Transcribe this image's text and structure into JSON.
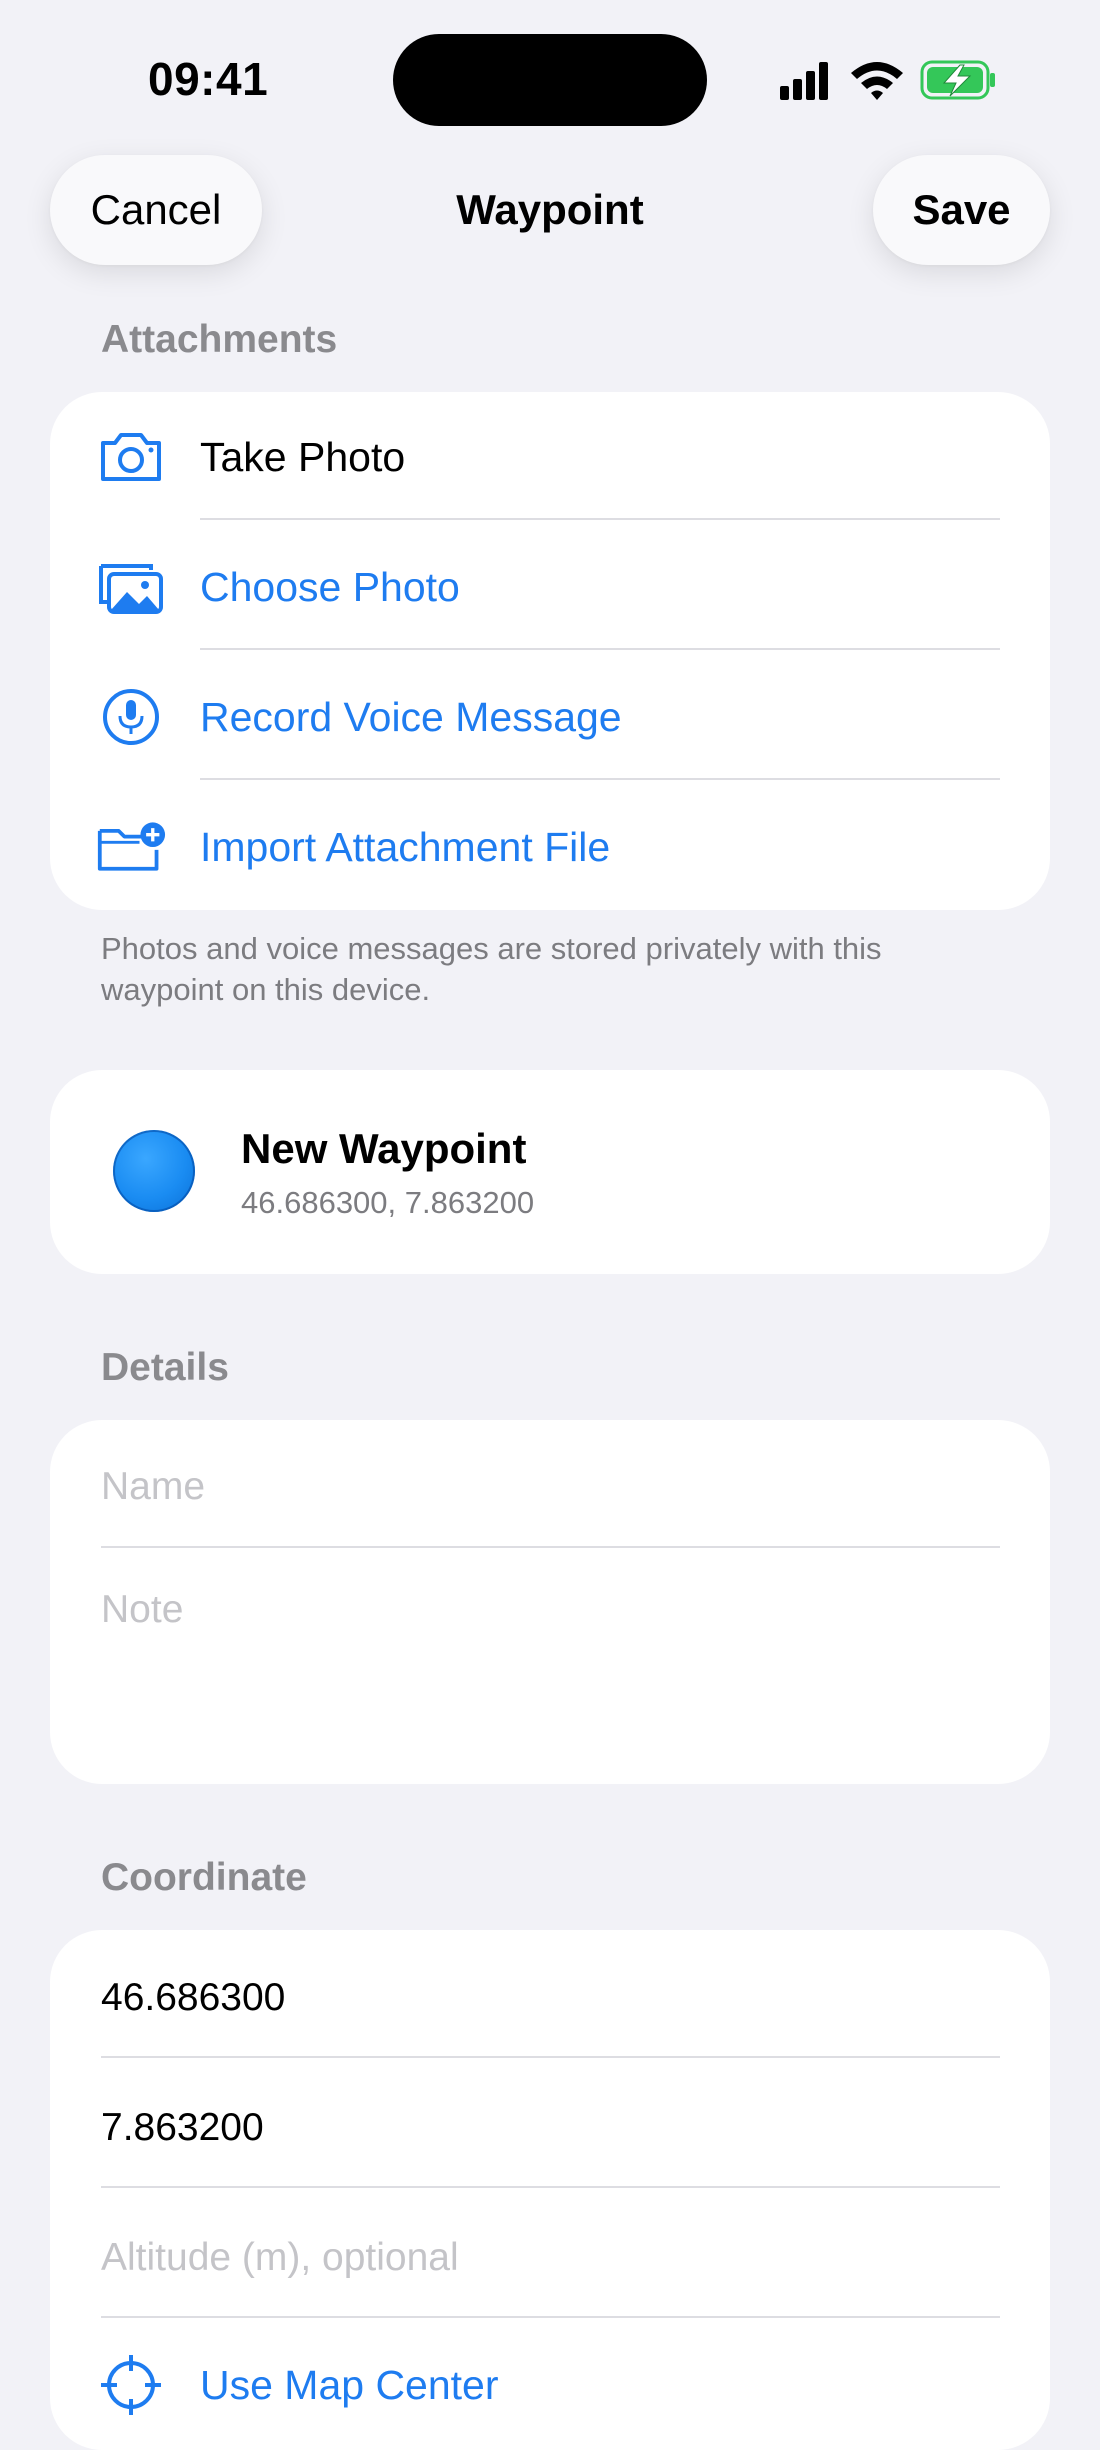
{
  "status_bar": {
    "time": "09:41"
  },
  "nav": {
    "cancel_label": "Cancel",
    "title": "Waypoint",
    "save_label": "Save"
  },
  "attachments": {
    "header": "Attachments",
    "items": [
      {
        "label": "Take Photo",
        "icon": "camera-icon"
      },
      {
        "label": "Choose Photo",
        "icon": "photo-library-icon"
      },
      {
        "label": "Record Voice Message",
        "icon": "microphone-icon"
      },
      {
        "label": "Import Attachment File",
        "icon": "folder-add-icon"
      }
    ],
    "footer": "Photos and voice messages are stored privately with this waypoint on this device."
  },
  "waypoint": {
    "name": "New Waypoint",
    "coords": "46.686300, 7.863200",
    "color": "#1A8CF2"
  },
  "details": {
    "header": "Details",
    "name_placeholder": "Name",
    "note_placeholder": "Note"
  },
  "coordinate": {
    "header": "Coordinate",
    "latitude": "46.686300",
    "longitude": "7.863200",
    "altitude_placeholder": "Altitude (m), optional",
    "map_center_label": "Use Map Center"
  },
  "colors": {
    "accent": "#1E7CF0",
    "background": "#F2F2F7",
    "battery": "#34C759"
  }
}
